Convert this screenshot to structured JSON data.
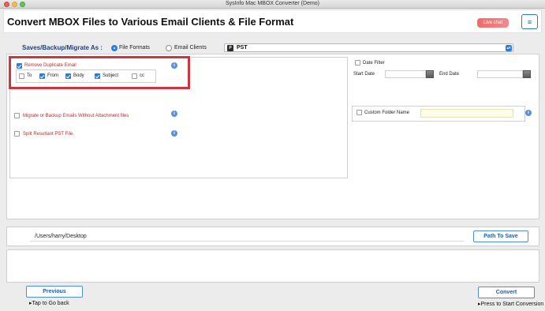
{
  "window": {
    "title": "SysInfo Mac MBOX Converter (Demo)"
  },
  "header": {
    "title": "Convert MBOX Files to Various Email Clients & File Format",
    "live_chat": "Live chat",
    "menu_icon": "≡"
  },
  "save_as": {
    "label": "Saves/Backup/Migrate As :",
    "options": [
      {
        "label": "File Formats",
        "selected": true
      },
      {
        "label": "Email Clients",
        "selected": false
      }
    ],
    "format_select": {
      "value": "PST",
      "icon": "pst-file-icon"
    }
  },
  "options": {
    "remove_duplicate": {
      "label": "Remove Duplicate Email",
      "checked": true
    },
    "fields": [
      {
        "label": "To",
        "checked": false
      },
      {
        "label": "From",
        "checked": true
      },
      {
        "label": "Body",
        "checked": true
      },
      {
        "label": "Subject",
        "checked": true
      },
      {
        "label": "cc",
        "checked": false
      }
    ],
    "migrate_without_attachment": {
      "label": "Migrate or Backup Emails Without Attachment files",
      "checked": false
    },
    "split_pst": {
      "label": "Split Resultant PST File.",
      "checked": false
    }
  },
  "date_filter": {
    "label": "Date Filter",
    "start_label": "Start Date",
    "end_label": "End Date",
    "checked": false
  },
  "custom_folder": {
    "label": "Custom Folder Name",
    "checked": false,
    "value": ""
  },
  "path": {
    "value": "/Users/harry/Desktop",
    "button": "Path To Save"
  },
  "footer": {
    "previous_button": "Previous",
    "previous_hint": "▸Tap to Go back",
    "convert_button": "Convert",
    "convert_hint": "▸Press to Start Conversion"
  },
  "colors": {
    "accent": "#2c7be5",
    "highlight": "#d0343d",
    "title_blue": "#1e3f80"
  }
}
